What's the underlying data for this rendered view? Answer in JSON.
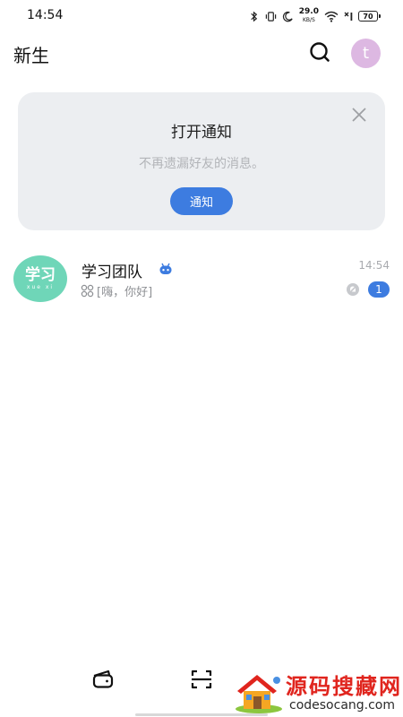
{
  "status_bar": {
    "time": "14:54",
    "net_speed": "29.0",
    "net_unit": "KB/S",
    "battery": "70"
  },
  "header": {
    "title": "新生",
    "avatar_letter": "t"
  },
  "notification": {
    "title": "打开通知",
    "subtitle": "不再遗漏好友的消息。",
    "button_label": "通知"
  },
  "chats": [
    {
      "avatar_text": "学习",
      "avatar_subtext": "xue xi",
      "name": "学习团队",
      "time": "14:54",
      "preview": "[嗨，你好]",
      "unread": "1",
      "muted": true
    }
  ],
  "watermark": {
    "text": "源码搜藏网",
    "url": "codesocang.com"
  },
  "colors": {
    "accent": "#3d7ce0",
    "card_bg": "#eceef1",
    "chat_avatar": "#6fd6b8",
    "my_avatar": "#ddb8e2"
  },
  "icons": [
    "bluetooth-icon",
    "vibrate-icon",
    "moon-icon",
    "wifi-icon",
    "signal-icon",
    "battery-icon",
    "search-icon",
    "close-icon",
    "bot-icon",
    "group-icon",
    "mute-icon",
    "wallet-icon",
    "scan-icon"
  ]
}
